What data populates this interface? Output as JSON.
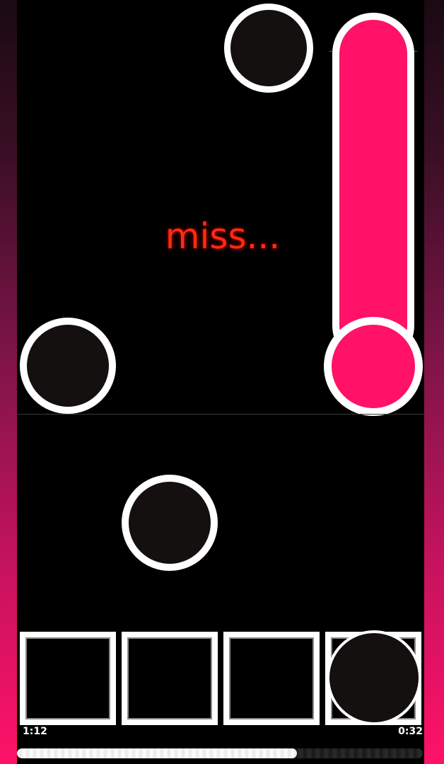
{
  "judgement": {
    "text": "miss..."
  },
  "timer": {
    "elapsed": "1:12",
    "remaining": "0:32"
  },
  "progress": {
    "fraction": 0.69
  },
  "colors": {
    "accent": "#ff1268",
    "judgement_miss": "#ff2a10",
    "note_fill": "#141010",
    "note_border": "#ffffff"
  },
  "lanes": {
    "count": 4
  }
}
